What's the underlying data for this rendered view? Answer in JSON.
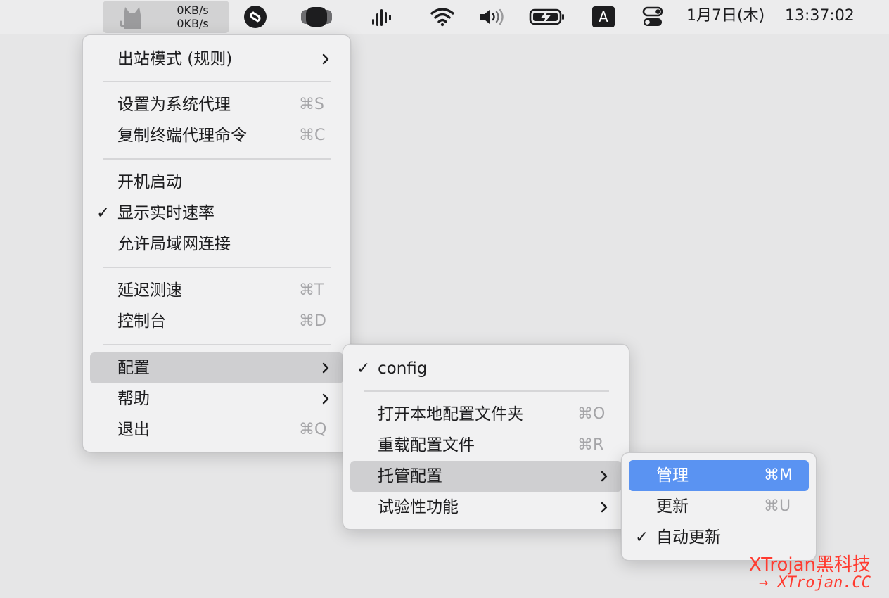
{
  "menubar": {
    "upload_speed": "0KB/s",
    "download_speed": "0KB/s",
    "input_method": "A",
    "date": "1月7日(木)",
    "time": "13:37:02",
    "icons": [
      "clash-cat-icon",
      "shazam-icon",
      "app-rounded-square-icon",
      "audio-bars-icon",
      "wifi-icon",
      "volume-icon",
      "battery-charging-icon",
      "input-source-icon",
      "control-center-icon"
    ]
  },
  "main_menu": {
    "items": [
      {
        "label": "出站模式 (规则)",
        "has_submenu": true
      },
      {
        "label": "设置为系统代理",
        "shortcut": "⌘S"
      },
      {
        "label": "复制终端代理命令",
        "shortcut": "⌘C"
      },
      {
        "label": "开机启动"
      },
      {
        "label": "显示实时速率",
        "checked": true,
        "check": "✓"
      },
      {
        "label": "允许局域网连接"
      },
      {
        "label": "延迟测速",
        "shortcut": "⌘T"
      },
      {
        "label": "控制台",
        "shortcut": "⌘D"
      },
      {
        "label": "配置",
        "has_submenu": true,
        "highlighted": true
      },
      {
        "label": "帮助",
        "has_submenu": true
      },
      {
        "label": "退出",
        "shortcut": "⌘Q"
      }
    ]
  },
  "config_submenu": {
    "items": [
      {
        "label": "config",
        "checked": true,
        "check": "✓"
      },
      {
        "label": "打开本地配置文件夹",
        "shortcut": "⌘O"
      },
      {
        "label": "重载配置文件",
        "shortcut": "⌘R"
      },
      {
        "label": "托管配置",
        "has_submenu": true,
        "highlighted": true
      },
      {
        "label": "试验性功能",
        "has_submenu": true
      }
    ]
  },
  "remote_submenu": {
    "items": [
      {
        "label": "管理",
        "shortcut": "⌘M",
        "selected": true
      },
      {
        "label": "更新",
        "shortcut": "⌘U"
      },
      {
        "label": "自动更新",
        "checked": true,
        "check": "✓"
      }
    ]
  },
  "watermark": {
    "line1": "XTrojan黑科技",
    "line2": "→ XTrojan.CC"
  },
  "colors": {
    "selected": "#5a93f2",
    "highlight": "#cfcfd1",
    "watermark": "#ff3b30"
  }
}
